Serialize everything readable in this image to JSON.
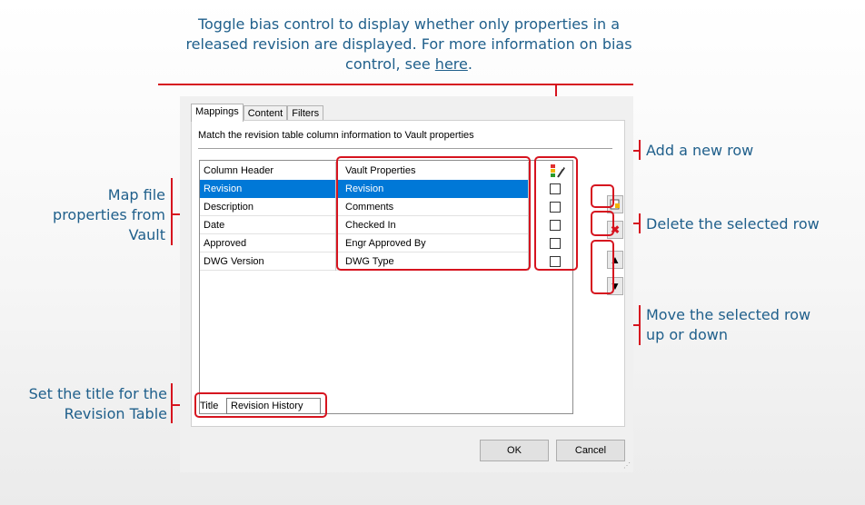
{
  "callouts": {
    "bias_line1": "Toggle bias control to display whether only properties in a",
    "bias_line2": "released revision are displayed. For more information on bias",
    "bias_line3_pre": "control, see ",
    "bias_link": "here",
    "bias_line3_post": ".",
    "add_row": "Add a new row",
    "delete_row": "Delete the selected row",
    "move_line1": "Move the selected row",
    "move_line2": "up or down",
    "map_line1": "Map file",
    "map_line2": "properties from",
    "map_line3": "Vault",
    "title_line1": "Set the title for the",
    "title_line2": "Revision Table"
  },
  "tabs": [
    {
      "label": "Mappings",
      "active": true
    },
    {
      "label": "Content",
      "active": false
    },
    {
      "label": "Filters",
      "active": false
    }
  ],
  "panel": {
    "description": "Match the revision table column information to Vault properties"
  },
  "grid": {
    "headers": {
      "column_header": "Column Header",
      "vault_properties": "Vault Properties",
      "bias_icon": "bias-control-icon"
    },
    "rows": [
      {
        "column": "Revision",
        "property": "Revision",
        "checked": false,
        "selected": true
      },
      {
        "column": "Description",
        "property": "Comments",
        "checked": false,
        "selected": false
      },
      {
        "column": "Date",
        "property": "Checked In",
        "checked": false,
        "selected": false
      },
      {
        "column": "Approved",
        "property": "Engr Approved By",
        "checked": false,
        "selected": false
      },
      {
        "column": "DWG Version",
        "property": "DWG Type",
        "checked": false,
        "selected": false
      }
    ]
  },
  "side_buttons": {
    "add_icon": "add-row-icon",
    "delete_icon": "delete-row-icon",
    "up_icon": "arrow-up-icon",
    "down_icon": "arrow-down-icon"
  },
  "title_field": {
    "label": "Title",
    "value": "Revision History"
  },
  "buttons": {
    "ok": "OK",
    "cancel": "Cancel"
  },
  "colors": {
    "accent": "#d6141f",
    "callout_text": "#1f5f8b",
    "selection": "#0078d7"
  }
}
